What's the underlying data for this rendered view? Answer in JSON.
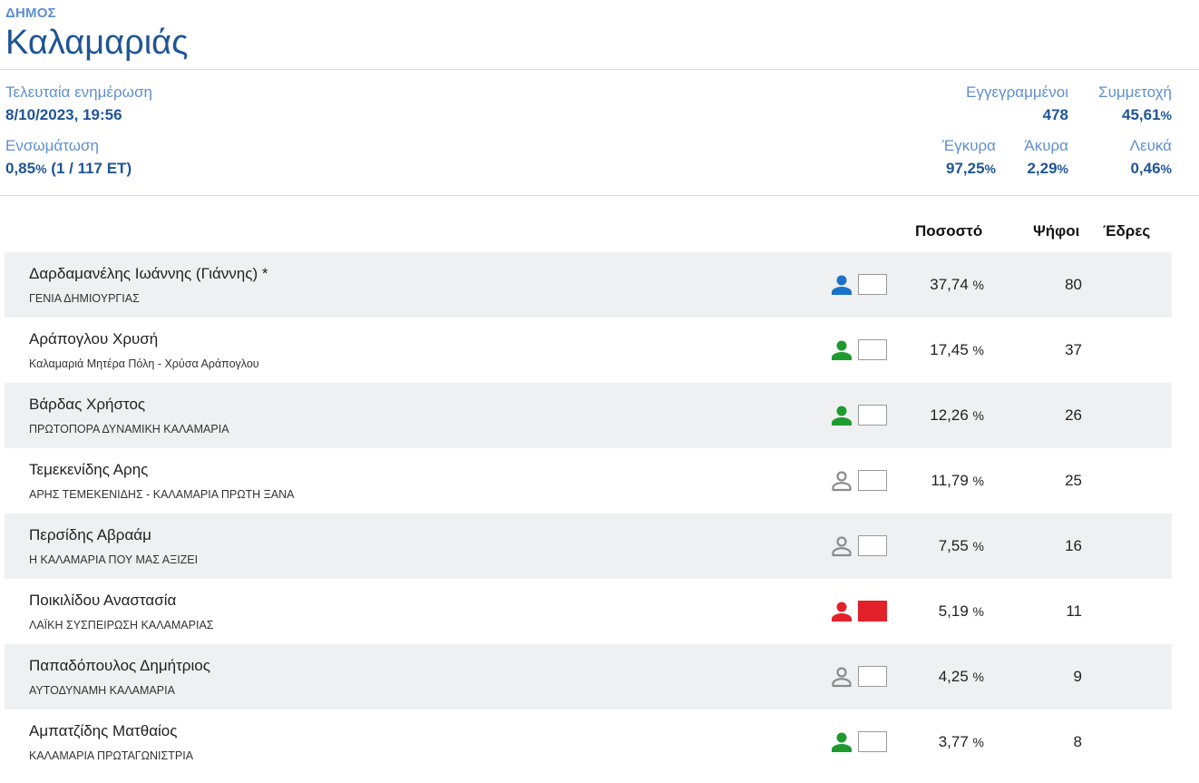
{
  "header": {
    "kicker": "ΔΗΜΟΣ",
    "title": "Καλαμαριάς"
  },
  "stats": {
    "update_label": "Τελευταία ενημέρωση",
    "update_value": "8/10/2023, 19:56",
    "integration_label": "Ενσωμάτωση",
    "integration_pct": "0,85",
    "integration_rest": "(1 / 117 ΕΤ)",
    "registered_label": "Εγγεγραμμένοι",
    "registered_value": "478",
    "turnout_label": "Συμμετοχή",
    "turnout_value": "45,61",
    "valid_label": "Έγκυρα",
    "valid_value": "97,25",
    "invalid_label": "Άκυρα",
    "invalid_value": "2,29",
    "blank_label": "Λευκά",
    "blank_value": "0,46",
    "percent_sign": "%"
  },
  "table": {
    "col_percent": "Ποσοστό",
    "col_votes": "Ψήφοι",
    "col_seats": "Έδρες",
    "percent_unit": "%",
    "rows": [
      {
        "name": "Δαρδαμανέλης Ιωάννης (Γιάννης) *",
        "party": "ΓΕΝΙΑ ΔΗΜΙΟΥΡΓΙΑΣ",
        "percent": "37,74",
        "votes": "80",
        "seats": "",
        "icon": "person-icon",
        "person_color": "#1a73c9",
        "box_color": "#ffffff"
      },
      {
        "name": "Αράπογλου Χρυσή",
        "party": "Καλαμαριά Μητέρα Πόλη - Χρύσα Αράπογλου",
        "percent": "17,45",
        "votes": "37",
        "seats": "",
        "icon": "person-icon",
        "person_color": "#1f9a2e",
        "box_color": "#ffffff"
      },
      {
        "name": "Βάρδας Χρήστος",
        "party": "ΠΡΩΤΟΠΟΡΑ ΔΥΝΑΜΙΚΗ ΚΑΛΑΜΑΡΙΑ",
        "percent": "12,26",
        "votes": "26",
        "seats": "",
        "icon": "person-icon",
        "person_color": "#1f9a2e",
        "box_color": "#ffffff"
      },
      {
        "name": "Τεμεκενίδης Αρης",
        "party": "ΑΡΗΣ ΤΕΜΕΚΕΝΙΔΗΣ - ΚΑΛΑΜΑΡΙΑ ΠΡΩΤΗ ΞΑΝΑ",
        "percent": "11,79",
        "votes": "25",
        "seats": "",
        "icon": "person-outline-icon",
        "person_color": "#8c8c8c",
        "box_color": "#ffffff"
      },
      {
        "name": "Περσίδης Αβραάμ",
        "party": "Η ΚΑΛΑΜΑΡΙΑ ΠΟΥ ΜΑΣ ΑΞΙΖΕΙ",
        "percent": "7,55",
        "votes": "16",
        "seats": "",
        "icon": "person-outline-icon",
        "person_color": "#8c8c8c",
        "box_color": "#ffffff"
      },
      {
        "name": "Ποικιλίδου Αναστασία",
        "party": "ΛΑΪΚΗ ΣΥΣΠΕΙΡΩΣΗ ΚΑΛΑΜΑΡΙΑΣ",
        "percent": "5,19",
        "votes": "11",
        "seats": "",
        "icon": "person-icon",
        "person_color": "#e3212b",
        "box_color": "#e3212b"
      },
      {
        "name": "Παπαδόπουλος Δημήτριος",
        "party": "ΑΥΤΟΔΥΝΑΜΗ ΚΑΛΑΜΑΡΙΑ",
        "percent": "4,25",
        "votes": "9",
        "seats": "",
        "icon": "person-outline-icon",
        "person_color": "#8c8c8c",
        "box_color": "#ffffff"
      },
      {
        "name": "Αμπατζίδης Ματθαίος",
        "party": "ΚΑΛΑΜΑΡΙΑ ΠΡΩΤΑΓΩΝΙΣΤΡΙΑ",
        "percent": "3,77",
        "votes": "8",
        "seats": "",
        "icon": "person-icon",
        "person_color": "#1f9a2e",
        "box_color": "#ffffff"
      }
    ]
  }
}
